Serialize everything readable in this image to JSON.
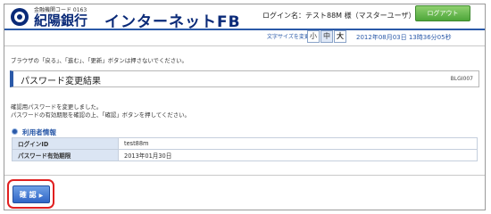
{
  "header": {
    "bank_code": "金融機関コード 0163",
    "bank_name": "紀陽銀行",
    "service_name": "インターネットFB",
    "login_name": "ログイン名：テスト88M 様（マスターユーザ）",
    "logout_label": "ログアウト"
  },
  "subheader": {
    "font_size_label": "文字サイズを変更",
    "font_sizes": [
      "小",
      "中",
      "大"
    ],
    "datetime": "2012年08月03日 13時36分05秒"
  },
  "main": {
    "warning": "ブラウザの「戻る」、「進む」、「更新」ボタンは押さないでください。",
    "title": "パスワード変更結果",
    "screen_id": "BLGI007",
    "message_line1": "確認用パスワードを変更しました。",
    "message_line2": "パスワードの有効期限を確認の上、「確認」ボタンを押してください。",
    "section_title": "利用者情報",
    "table_rows": [
      {
        "label": "ログインID",
        "value": "test88m"
      },
      {
        "label": "パスワード有効期限",
        "value": "2013年01月30日"
      }
    ],
    "confirm_label": "確 認"
  },
  "colors": {
    "brand_blue": "#0a2a78",
    "accent_blue": "#2a59a8",
    "logout_green": "#4ea63a",
    "highlight_red": "#e02020"
  }
}
